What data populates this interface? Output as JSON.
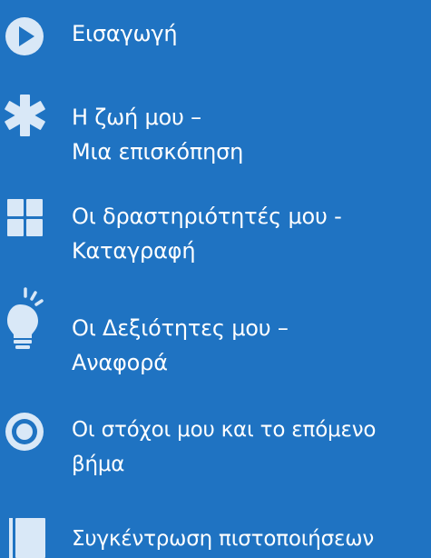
{
  "colors": {
    "background": "#1f73c2",
    "text": "#ffffff",
    "icon_fill": "#d9e8f7",
    "icon_accent": "#1f73c2"
  },
  "menu": {
    "items": [
      {
        "icon": "play-circle-icon",
        "lines": [
          "Εισαγωγή"
        ]
      },
      {
        "icon": "asterisk-icon",
        "lines": [
          "Η ζωή μου –",
          "Μια επισκόπηση"
        ]
      },
      {
        "icon": "grid-icon",
        "lines": [
          "Οι δραστηριότητές μου -",
          "Καταγραφή"
        ]
      },
      {
        "icon": "lightbulb-icon",
        "lines": [
          "Οι Δεξιότητες μου –",
          "Αναφορά"
        ]
      },
      {
        "icon": "target-icon",
        "lines": [
          "Οι στόχοι μου και το επόμενο",
          "βήμα"
        ]
      },
      {
        "icon": "folder-icon",
        "lines": [
          "Συγκέντρωση πιστοποιήσεων"
        ]
      }
    ]
  }
}
